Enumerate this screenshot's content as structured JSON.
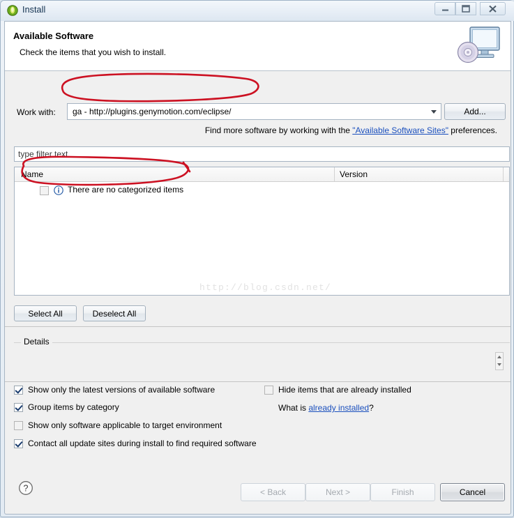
{
  "window": {
    "title": "Install",
    "app_icon": "eclipse-icon",
    "controls": {
      "minimize": "minimize-icon",
      "maximize": "maximize-icon",
      "close": "close-icon"
    }
  },
  "banner": {
    "title": "Available Software",
    "subtitle": "Check the items that you wish to install.",
    "graphic": "monitor-disc-icon"
  },
  "work_with": {
    "label": "Work with:",
    "value": "ga - http://plugins.genymotion.com/eclipse/",
    "add_button": "Add..."
  },
  "find_more": {
    "prefix": "Find more software by working with the ",
    "link": "\"Available Software Sites\"",
    "suffix": " preferences."
  },
  "filter": {
    "placeholder": "type filter text",
    "value": ""
  },
  "table": {
    "columns": [
      "Name",
      "Version"
    ],
    "rows": [
      {
        "checked": false,
        "icon": "info-icon",
        "name": "There are no categorized items",
        "version": ""
      }
    ],
    "watermark": "http://blog.csdn.net/"
  },
  "selection_buttons": {
    "select_all": "Select All",
    "deselect_all": "Deselect All"
  },
  "details": {
    "legend": "Details",
    "content": ""
  },
  "options": [
    {
      "label": "Show only the latest versions of available software",
      "checked": true
    },
    {
      "label": "Group items by category",
      "checked": true
    },
    {
      "label": "Show only software applicable to target environment",
      "checked": false
    },
    {
      "label": "Contact all update sites during install to find required software",
      "checked": true
    },
    {
      "label": "Hide items that are already installed",
      "checked": false
    }
  ],
  "what_is": {
    "prefix": "What is ",
    "link": "already installed",
    "suffix": "?"
  },
  "footer": {
    "help_icon": "help-icon",
    "buttons": [
      {
        "label": "< Back",
        "enabled": false
      },
      {
        "label": "Next >",
        "enabled": false
      },
      {
        "label": "Finish",
        "enabled": false
      },
      {
        "label": "Cancel",
        "enabled": true
      }
    ]
  },
  "annotations": {
    "color": "#cc1122",
    "marks": [
      "ellipse-around-work-with-url",
      "ellipse-around-no-categorized-items"
    ]
  }
}
